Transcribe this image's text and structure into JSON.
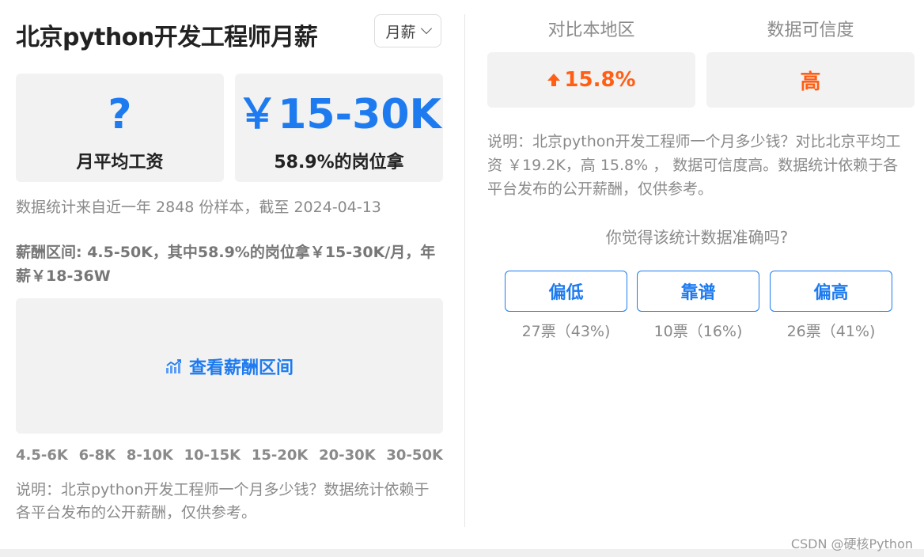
{
  "header": {
    "title": "北京python开发工程师月薪",
    "period_select": {
      "selected": "月薪"
    }
  },
  "stats": {
    "avg_salary": {
      "value": "?",
      "label": "月平均工资"
    },
    "common_range": {
      "value": "￥15-30K",
      "label": "58.9%的岗位拿"
    }
  },
  "sample_note": "数据统计来自近一年 2848 份样本，截至 2024-04-13",
  "range_text": "薪酬区间: 4.5-50K，其中58.9%的岗位拿￥15-30K/月，年薪￥18-36W",
  "chart": {
    "button_label": "查看薪酬区间",
    "icon": "chart-icon"
  },
  "bins": [
    "4.5-6K",
    "6-8K",
    "8-10K",
    "10-15K",
    "15-20K",
    "20-30K",
    "30-50K"
  ],
  "bottom_note": "说明：北京python开发工程师一个月多少钱？数据统计依赖于各平台发布的公开薪酬，仅供参考。",
  "comparison": {
    "region_label": "对比本地区",
    "region_value": "15.8%",
    "region_icon": "arrow-up-icon",
    "confidence_label": "数据可信度",
    "confidence_value": "高",
    "accent_color": "#ff5f15"
  },
  "right_note": "说明：北京python开发工程师一个月多少钱？对比北京平均工资 ￥19.2K，高 15.8% ， 数据可信度高。数据统计依赖于各平台发布的公开薪酬，仅供参考。",
  "poll": {
    "question": "你觉得该统计数据准确吗?",
    "options": [
      {
        "label": "偏低",
        "count": "27票（43%)"
      },
      {
        "label": "靠谱",
        "count": "10票（16%)"
      },
      {
        "label": "偏高",
        "count": "26票（41%)"
      }
    ],
    "accent_color": "#1e7bef"
  },
  "watermark": "CSDN @硬核Python"
}
